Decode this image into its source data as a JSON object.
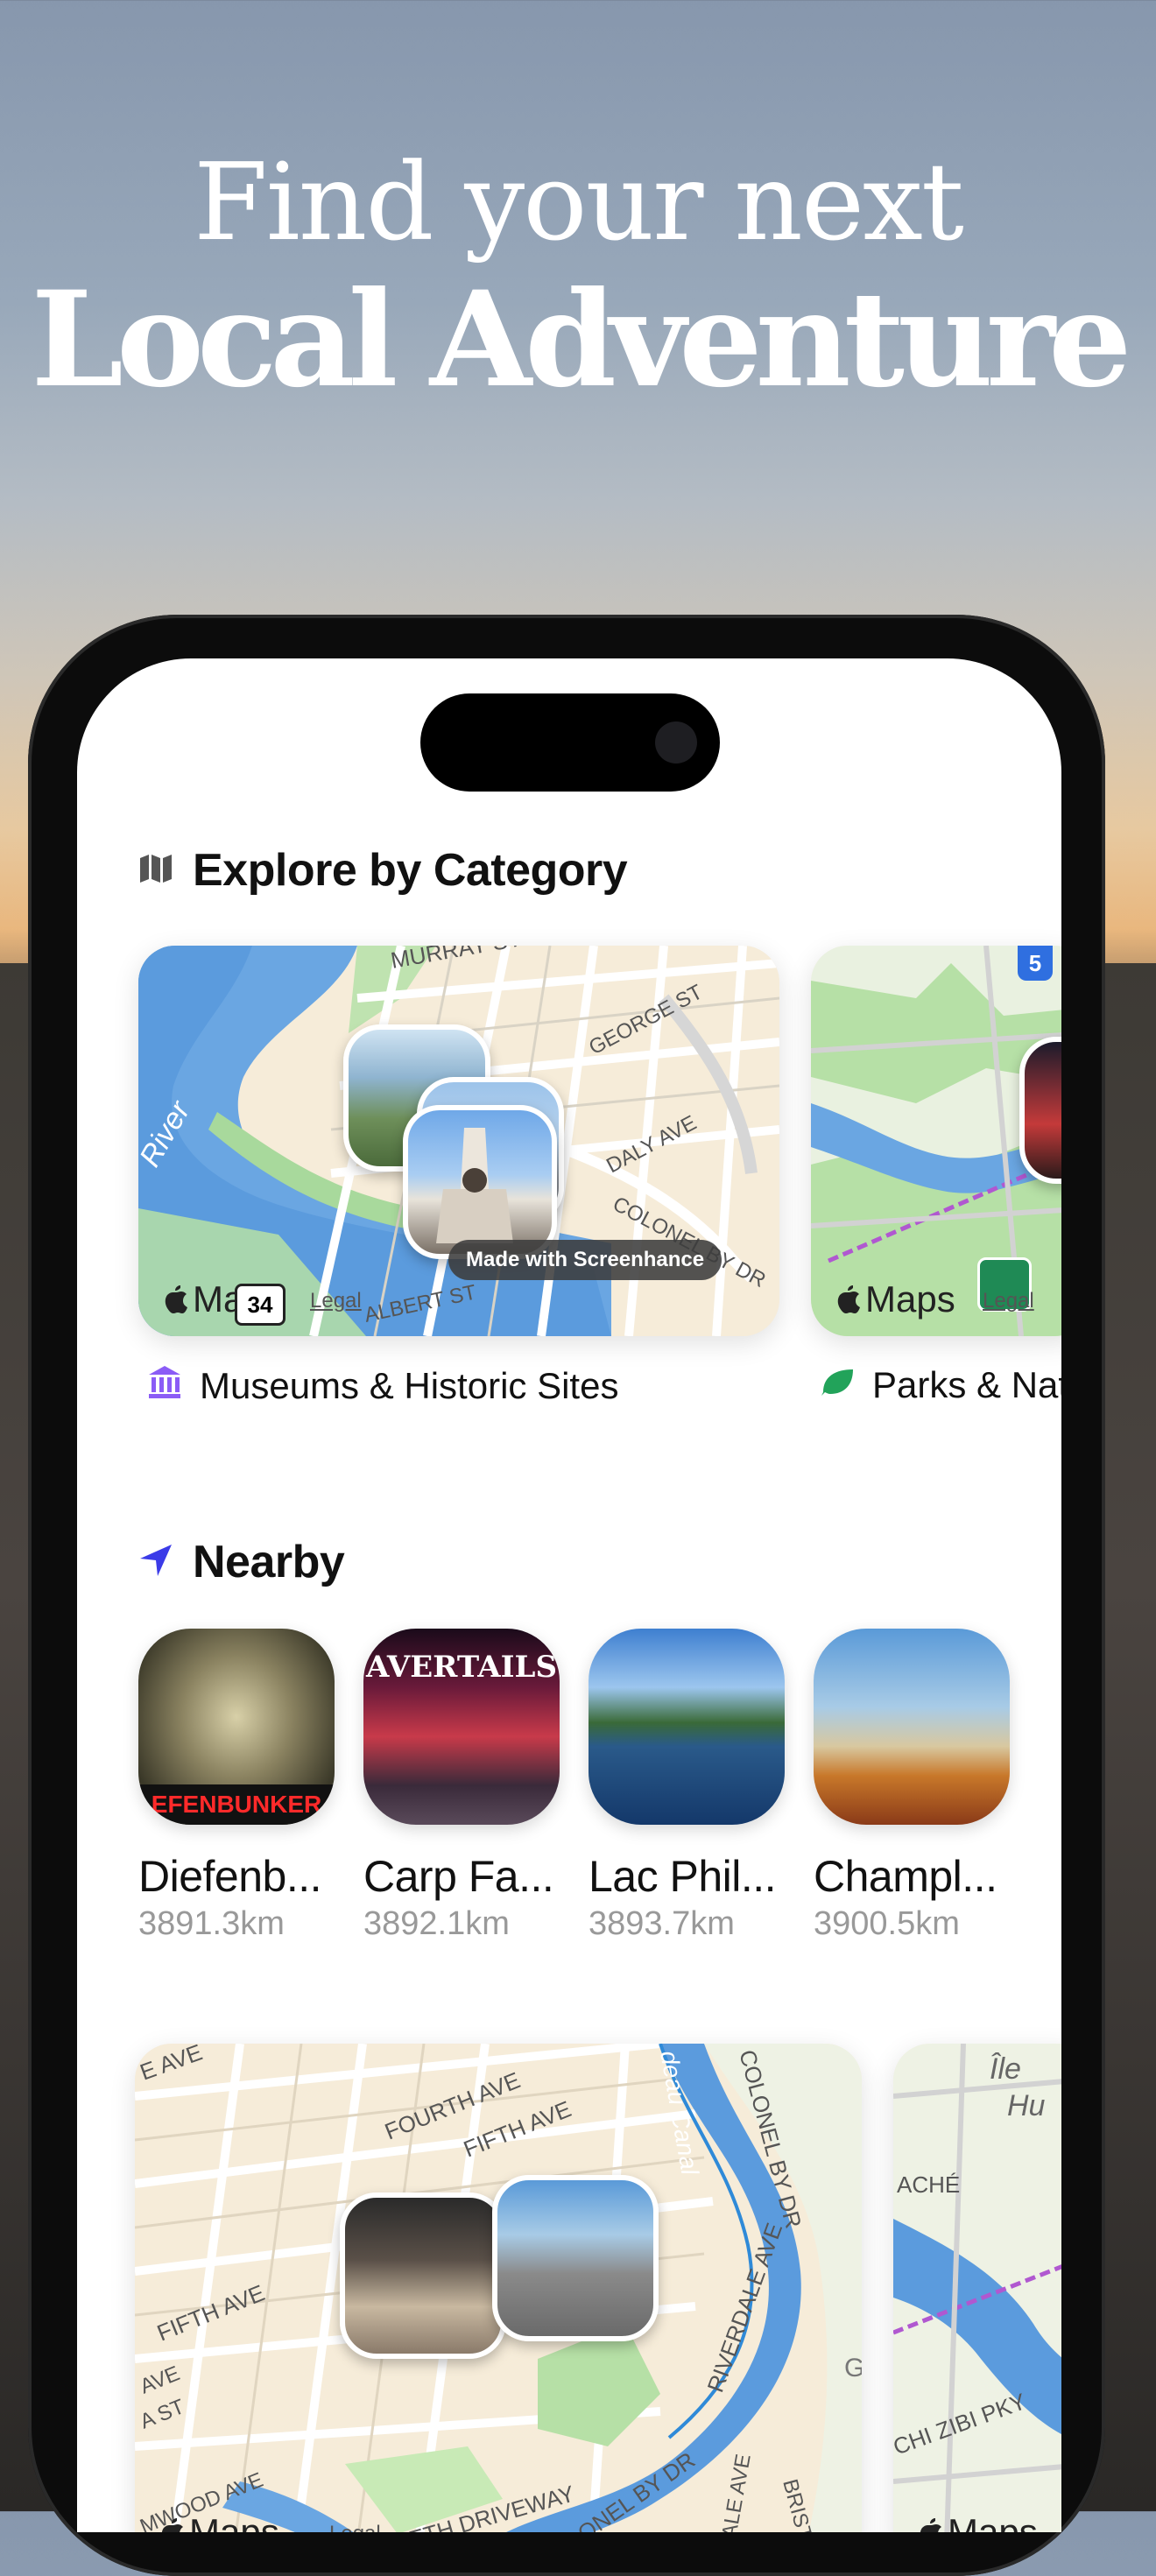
{
  "headline": {
    "line1": "Find your next",
    "line2": "Local Adventure"
  },
  "explore": {
    "title": "Explore by Category",
    "icon": "map-icon",
    "cards": [
      {
        "label": "Museums & Historic Sites",
        "icon": "museum-icon",
        "icon_color": "#8b5cf6",
        "map_brand": "Maps",
        "legal": "Legal",
        "watermark": "Made with Screenhance",
        "streets": [
          "MURRAY ST",
          "GEORGE ST",
          "DALY AVE",
          "COLONEL BY DR",
          "River",
          "ALBERT ST",
          "ST"
        ],
        "shield": "34"
      },
      {
        "label": "Parks & Nat",
        "icon": "leaf-icon",
        "icon_color": "#22a35a",
        "map_brand": "Maps",
        "legal": "Legal",
        "shield": "5"
      }
    ]
  },
  "nearby": {
    "title": "Nearby",
    "icon": "location-arrow-icon",
    "icon_color": "#3b3be8",
    "items": [
      {
        "name": "Diefenb...",
        "distance": "3891.3km",
        "caption": "EFENBUNKER"
      },
      {
        "name": "Carp Fa...",
        "distance": "3892.1km",
        "caption": "AVERTAILS"
      },
      {
        "name": "Lac Phil...",
        "distance": "3893.7km"
      },
      {
        "name": "Champl...",
        "distance": "3900.5km"
      }
    ]
  },
  "bottom_maps": [
    {
      "map_brand": "Maps",
      "legal": "Legal",
      "streets": [
        "E AVE",
        "FOURTH AVE",
        "FIFTH AVE",
        "FIFTH AVE",
        "COLONEL BY DR",
        "deau Canal",
        "RIVERDALE AVE",
        "BRISTOL",
        "ELIZABETH DRIVEWAY",
        "COLONEL BY DR",
        "RDALE AVE",
        "MWOOD AVE",
        "A ST",
        "AVE",
        "G"
      ]
    },
    {
      "map_brand": "Maps",
      "streets": [
        "Île",
        "Hu",
        "ACHÉ",
        "CHI ZIBI PKY"
      ]
    }
  ]
}
